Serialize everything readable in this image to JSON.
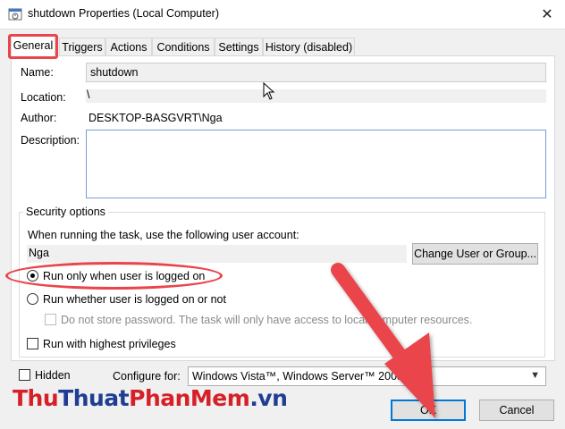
{
  "window": {
    "title": "shutdown Properties (Local Computer)",
    "close_glyph": "✕",
    "icon": "task-scheduler-icon"
  },
  "tabs": [
    {
      "label": "General",
      "active": true
    },
    {
      "label": "Triggers",
      "active": false
    },
    {
      "label": "Actions",
      "active": false
    },
    {
      "label": "Conditions",
      "active": false
    },
    {
      "label": "Settings",
      "active": false
    },
    {
      "label": "History (disabled)",
      "active": false
    }
  ],
  "general": {
    "name_label": "Name:",
    "name_value": "shutdown",
    "location_label": "Location:",
    "location_value": "\\",
    "author_label": "Author:",
    "author_value": "DESKTOP-BASGVRT\\Nga",
    "description_label": "Description:",
    "description_value": ""
  },
  "security": {
    "group_title": "Security options",
    "account_prompt": "When running the task, use the following user account:",
    "account_value": "Nga",
    "change_button": "Change User or Group...",
    "radio_logged_on": "Run only when user is logged on",
    "radio_logged_on_selected": true,
    "radio_whether": "Run whether user is logged on or not",
    "radio_whether_selected": false,
    "no_store_password": "Do not store password.  The task will only have access to local computer resources.",
    "highest_privileges": "Run with highest privileges"
  },
  "footer": {
    "hidden_label": "Hidden",
    "configure_label": "Configure for:",
    "configure_value": "Windows Vista™, Windows Server™ 2008",
    "ok": "OK",
    "cancel": "Cancel"
  },
  "watermark": {
    "part1": "Thu",
    "part2": "Thuat",
    "part3": "PhanMem",
    "part4": ".vn"
  },
  "colors": {
    "annotation_red": "#e9454b",
    "focus_blue": "#0078d7",
    "watermark_red": "#d62027",
    "watermark_blue": "#1f3e93"
  }
}
